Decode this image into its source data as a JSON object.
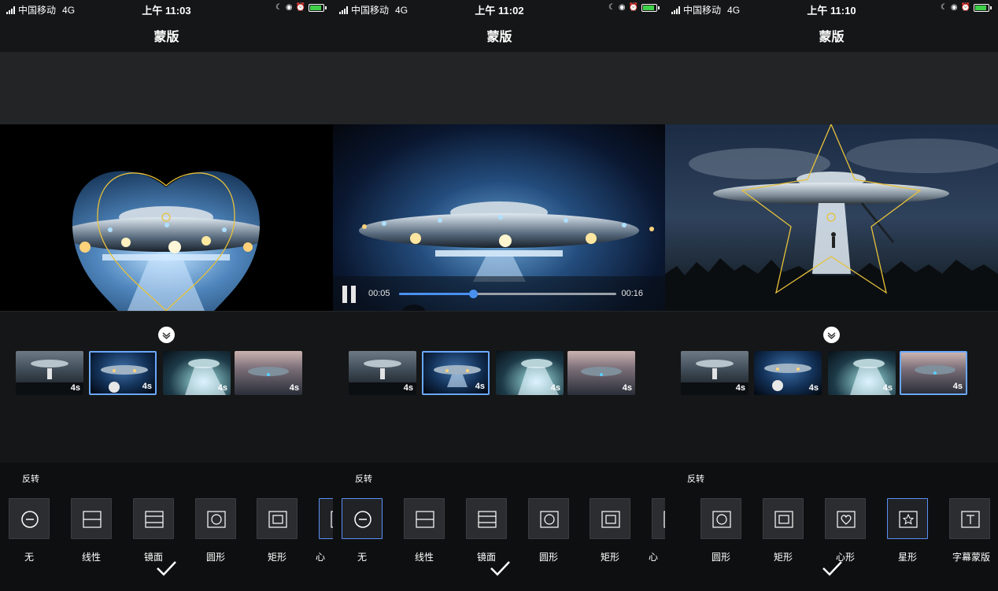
{
  "status": {
    "carrier": "中国移动",
    "network": "4G"
  },
  "screens": [
    {
      "time": "上午 11:03",
      "title": "蒙版",
      "invert": "反转",
      "thumbs": [
        "4s",
        "4s",
        "4s",
        "4s"
      ],
      "options": [
        "无",
        "线性",
        "镜面",
        "圆形",
        "矩形",
        "心"
      ]
    },
    {
      "time": "上午 11:02",
      "title": "蒙版",
      "invert": "反转",
      "player": {
        "current": "00:05",
        "total": "00:16",
        "progress": 0.34
      },
      "thumbs": [
        "4s",
        "4s",
        "4s",
        "4s"
      ],
      "options": [
        "无",
        "线性",
        "镜面",
        "圆形",
        "矩形",
        "心"
      ]
    },
    {
      "time": "上午 11:10",
      "title": "蒙版",
      "invert": "反转",
      "thumbs": [
        "4s",
        "4s",
        "4s",
        "4s"
      ],
      "options": [
        "圆形",
        "矩形",
        "心形",
        "星形",
        "字幕蒙版"
      ]
    }
  ],
  "colors": {
    "accent": "#6aa8ff",
    "mask_outline": "#e8c23a",
    "progress": "#4a90f0"
  }
}
